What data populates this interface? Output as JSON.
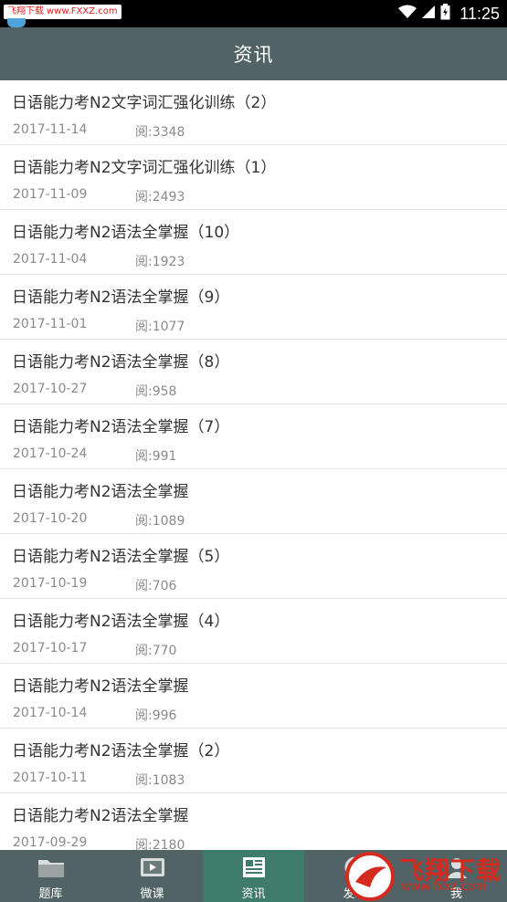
{
  "status_bar": {
    "watermark_cn": "飞翔下载",
    "watermark_url": "www.FXXZ.com",
    "time": "11:25"
  },
  "header": {
    "title": "资讯"
  },
  "news": [
    {
      "title": "日语能力考N2文字词汇强化训练（2）",
      "date": "2017-11-14",
      "views": "阅:3348"
    },
    {
      "title": "日语能力考N2文字词汇强化训练（1）",
      "date": "2017-11-09",
      "views": "阅:2493"
    },
    {
      "title": "日语能力考N2语法全掌握（10）",
      "date": "2017-11-04",
      "views": "阅:1923"
    },
    {
      "title": "日语能力考N2语法全掌握（9）",
      "date": "2017-11-01",
      "views": "阅:1077"
    },
    {
      "title": "日语能力考N2语法全掌握（8）",
      "date": "2017-10-27",
      "views": "阅:958"
    },
    {
      "title": "日语能力考N2语法全掌握（7）",
      "date": "2017-10-24",
      "views": "阅:991"
    },
    {
      "title": "日语能力考N2语法全掌握",
      "date": "2017-10-20",
      "views": "阅:1089"
    },
    {
      "title": "日语能力考N2语法全掌握（5）",
      "date": "2017-10-19",
      "views": "阅:706"
    },
    {
      "title": "日语能力考N2语法全掌握（4）",
      "date": "2017-10-17",
      "views": "阅:770"
    },
    {
      "title": "日语能力考N2语法全掌握",
      "date": "2017-10-14",
      "views": "阅:996"
    },
    {
      "title": "日语能力考N2语法全掌握（2）",
      "date": "2017-10-11",
      "views": "阅:1083"
    },
    {
      "title": "日语能力考N2语法全掌握",
      "date": "2017-09-29",
      "views": "阅:2180"
    }
  ],
  "nav": {
    "items": [
      {
        "label": "题库",
        "icon": "folder-icon"
      },
      {
        "label": "微课",
        "icon": "video-icon"
      },
      {
        "label": "资讯",
        "icon": "news-icon",
        "active": true
      },
      {
        "label": "发现",
        "icon": "discover-icon"
      },
      {
        "label": "我",
        "icon": "user-icon"
      }
    ]
  },
  "watermark": {
    "logo_text": "飞翔下载",
    "logo_url": "www.fxxz.com"
  },
  "colors": {
    "header_bg": "#516364",
    "nav_active_bg": "#3f7b6b",
    "divider": "#e3e3e3"
  }
}
